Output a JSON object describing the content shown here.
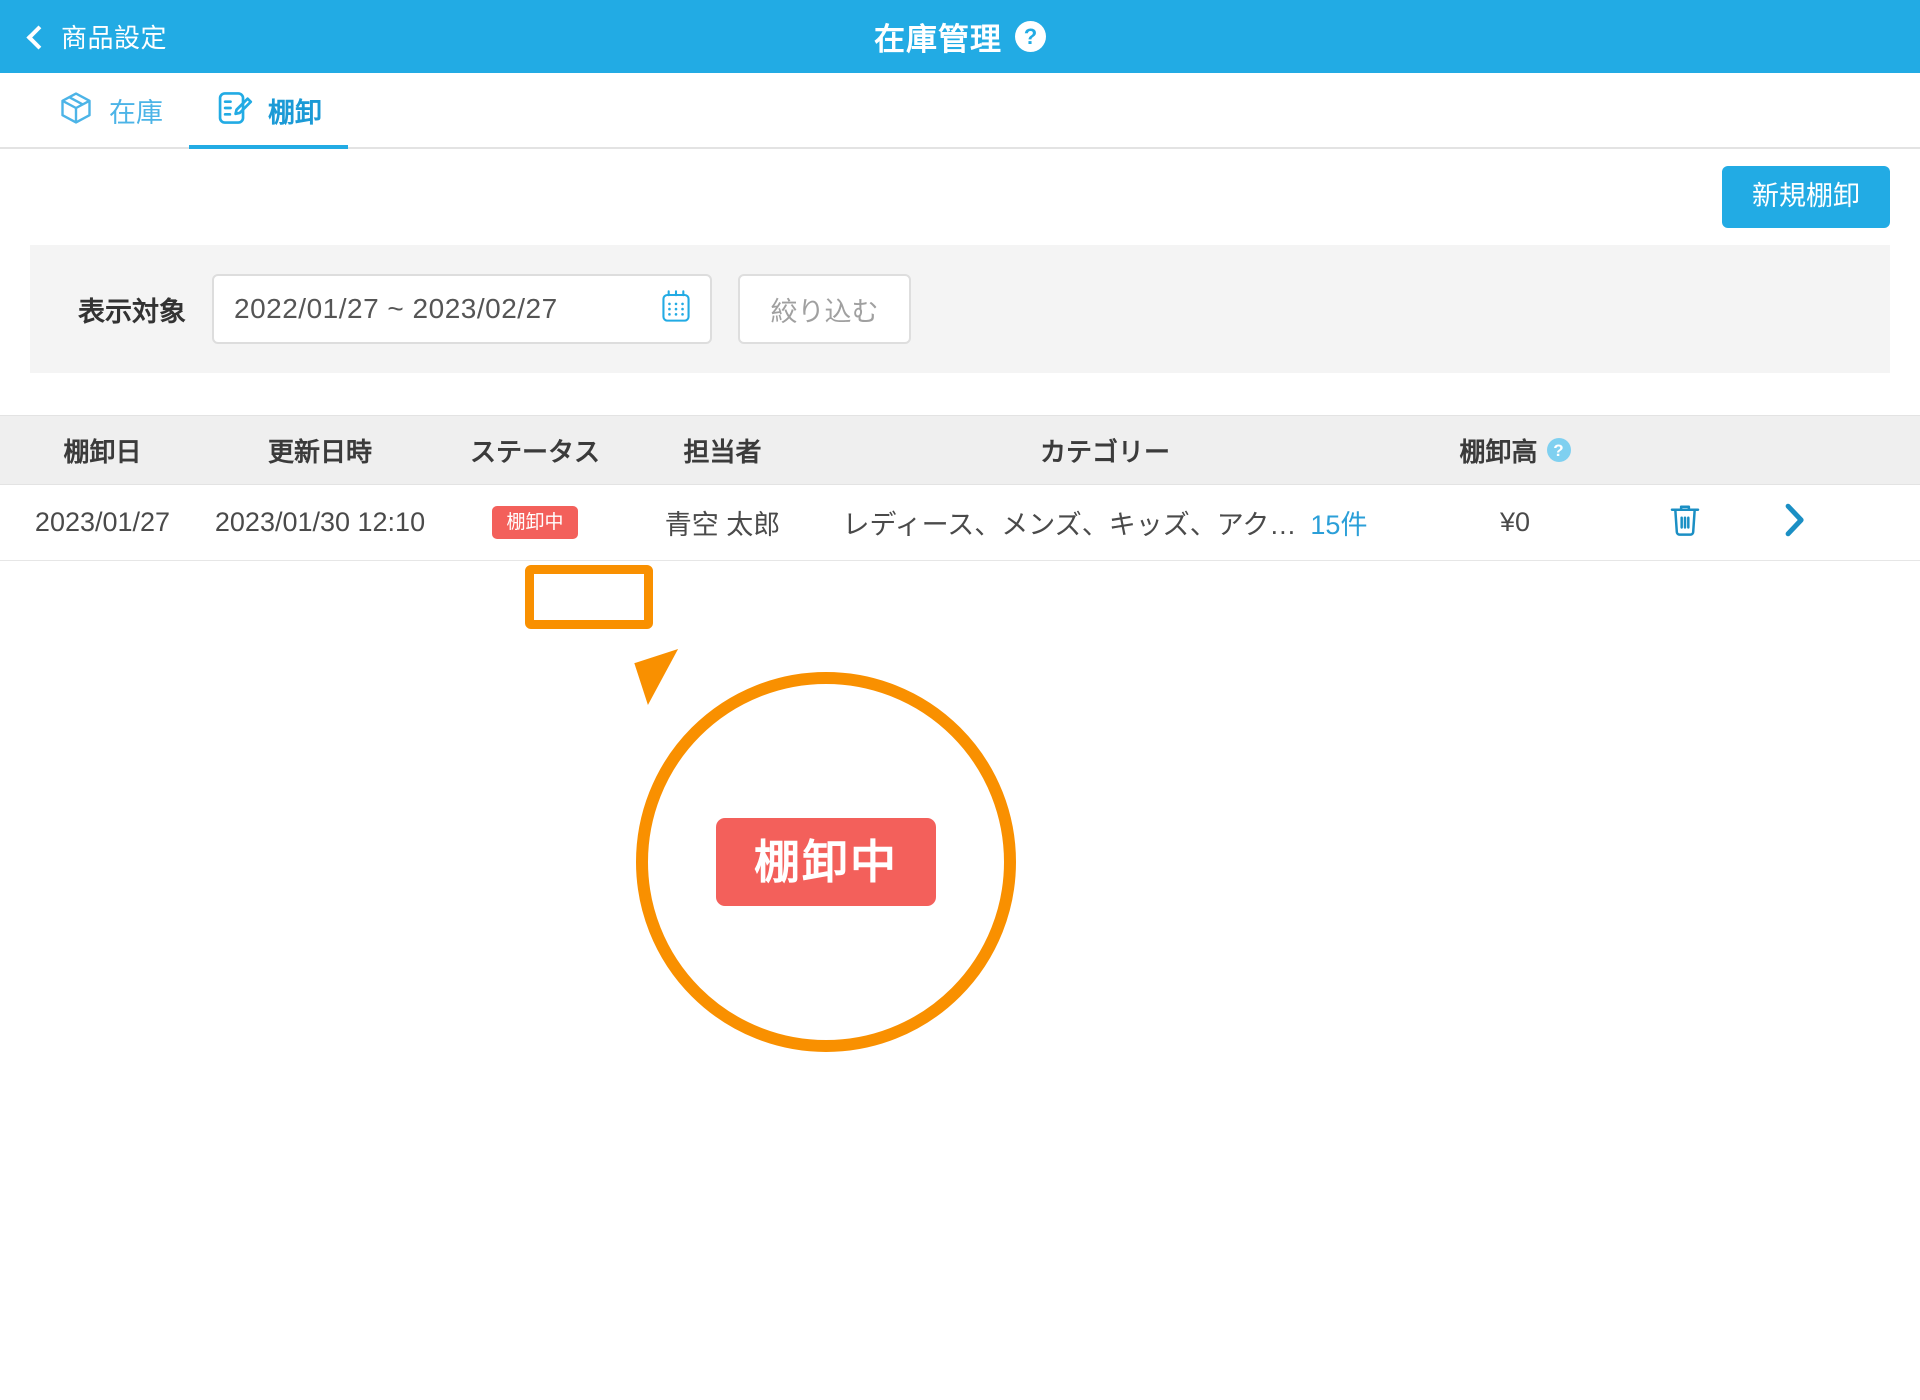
{
  "header": {
    "back_label": "商品設定",
    "back_icon": "chevron-left-icon",
    "title": "在庫管理",
    "help_icon": "?"
  },
  "tabs": [
    {
      "label": "在庫",
      "icon": "box-icon",
      "active": false
    },
    {
      "label": "棚卸",
      "icon": "clipboard-edit-icon",
      "active": true
    }
  ],
  "actions": {
    "new_stocktake": "新規棚卸"
  },
  "filter": {
    "label": "表示対象",
    "date_range": "2022/01/27 ~ 2023/02/27",
    "date_icon": "calendar-icon",
    "narrow_button": "絞り込む"
  },
  "table": {
    "columns": [
      {
        "key": "date",
        "label": "棚卸日"
      },
      {
        "key": "updated",
        "label": "更新日時"
      },
      {
        "key": "status",
        "label": "ステータス"
      },
      {
        "key": "person",
        "label": "担当者"
      },
      {
        "key": "category",
        "label": "カテゴリー"
      },
      {
        "key": "amount",
        "label": "棚卸高",
        "help": "?"
      }
    ],
    "rows": [
      {
        "date": "2023/01/27",
        "updated": "2023/01/30 12:10",
        "status": "棚卸中",
        "person": "青空 太郎",
        "category": "レディース、メンズ、キッズ、アク…",
        "category_count": "15件",
        "amount": "¥0",
        "delete_icon": "trash-icon",
        "detail_icon": "chevron-right-icon"
      }
    ]
  },
  "annotation": {
    "magnified_label": "棚卸中",
    "highlight_color": "#f99000",
    "badge_color": "#f3605b"
  },
  "colors": {
    "brand_blue": "#22abe4",
    "link_blue": "#2b9fd8",
    "status_red": "#f3605b",
    "annotation_orange": "#f99000",
    "panel_gray": "#f4f4f4",
    "thead_gray": "#efefef"
  }
}
